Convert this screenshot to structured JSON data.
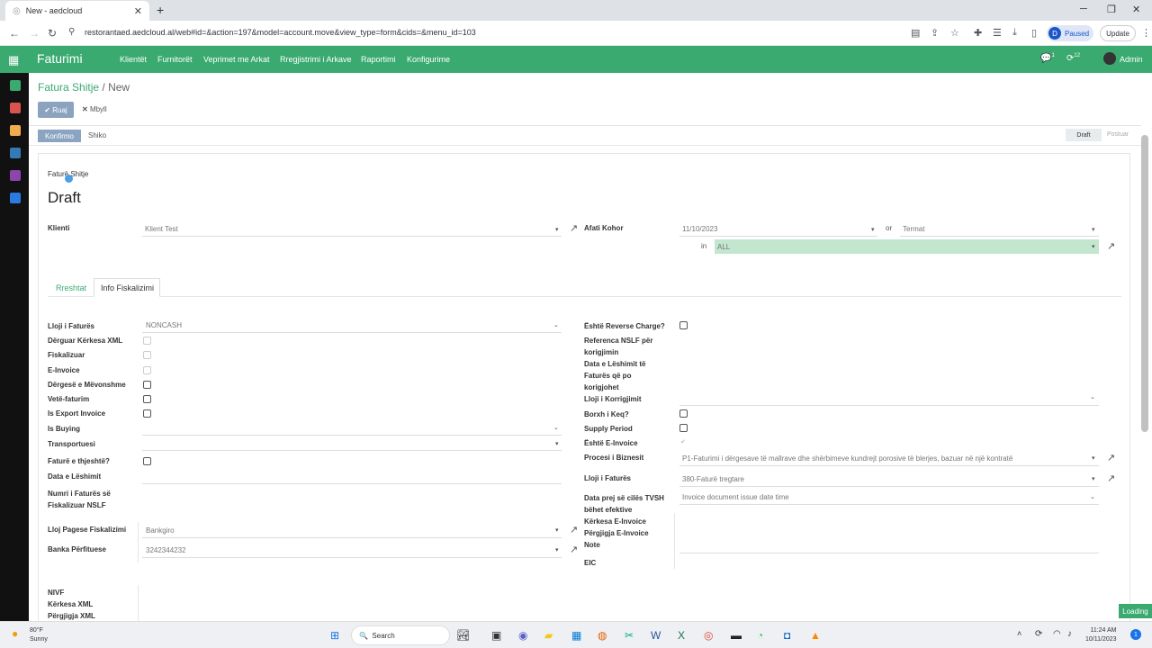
{
  "browser": {
    "tab_title": "New - aedcloud",
    "url": "restorantaed.aedcloud.al/web#id=&action=197&model=account.move&view_type=form&cids=&menu_id=103",
    "paused_label": "Paused",
    "profile_letter": "D",
    "update_label": "Update"
  },
  "app": {
    "brand": "Faturimi",
    "menu": [
      "Klientët",
      "Furnitorët",
      "Veprimet me Arkat",
      "Rregjistrimi i Arkave",
      "Raportimi",
      "Konfigurime"
    ],
    "chat_count": "1",
    "activity_count": "12",
    "user": "Admin"
  },
  "breadcrumb": {
    "parent": "Fatura Shitje",
    "sep": "/",
    "current": "New"
  },
  "actions": {
    "save": "Ruaj",
    "close": "Mbyll",
    "confirm": "Konfirmo",
    "preview": "Shiko"
  },
  "status": {
    "draft": "Draft",
    "posted": "Postuar"
  },
  "form": {
    "type_label": "Faturë Shitje",
    "name": "Draft",
    "client_label": "Klienti",
    "client_value": "Klient Test",
    "due_label": "Afati Kohor",
    "due_date": "11/10/2023",
    "or": "or",
    "terms_placeholder": "Termat",
    "in": "in",
    "journal": "ALL",
    "tabs": [
      "Rreshtat",
      "Info Fiskalizimi"
    ],
    "left": {
      "invoice_type_label": "Lloji i Faturës",
      "invoice_type_value": "NONCASH",
      "xml_sent": "Dërguar Kërkesa XML",
      "fiscalized": "Fiskalizuar",
      "einvoice": "E-Invoice",
      "late_send": "Dërgesë e Mëvonshme",
      "self_invoice": "Vetë-faturim",
      "export": "Is Export Invoice",
      "buying": "Is Buying",
      "transporter": "Transportuesi",
      "simple": "Faturë e thjeshtë?",
      "issue_date": "Data e Lëshimit",
      "fiscal_number": "Numri i Faturës së Fiskalizuar NSLF",
      "payment_type_label": "Lloj Pagese Fiskalizimi",
      "payment_type_value": "Bankgiro",
      "bank_label": "Banka Përfituese",
      "bank_value": "3242344232",
      "nivf": "NIVF",
      "xml_request": "Kërkesa XML",
      "xml_response": "Përgjigja XML"
    },
    "right": {
      "reverse_charge": "Është Reverse Charge?",
      "nslf_ref": "Referenca NSLF për korigjimin",
      "corrected_date": "Data e Lëshimit të Faturës që po korigjohet",
      "correction_type": "Lloji i Korrigjimit",
      "bad_debt": "Borxh i Keq?",
      "supply_period": "Supply Period",
      "is_einvoice": "Është E-Invoice",
      "business_process_label": "Procesi i Biznesit",
      "business_process_value": "P1-Faturimi i dërgesave të mallrave dhe shërbimeve kundrejt porosive të blerjes, bazuar në një kontratë",
      "invoice_type_label": "Lloji i Faturës",
      "invoice_type_value": "380-Faturë tregtare",
      "vat_date_label": "Data prej së cilës TVSH bëhet efektive",
      "vat_date_value": "Invoice document issue date time",
      "einv_request": "Kërkesa E-Invoice",
      "einv_response": "Përgjigja E-Invoice",
      "note": "Note",
      "eic": "EIC"
    }
  },
  "taskbar": {
    "temp": "80°F",
    "weather": "Sunny",
    "search": "Search",
    "time": "11:24 AM",
    "date": "10/11/2023",
    "notif": "1"
  },
  "loading": "Loading"
}
